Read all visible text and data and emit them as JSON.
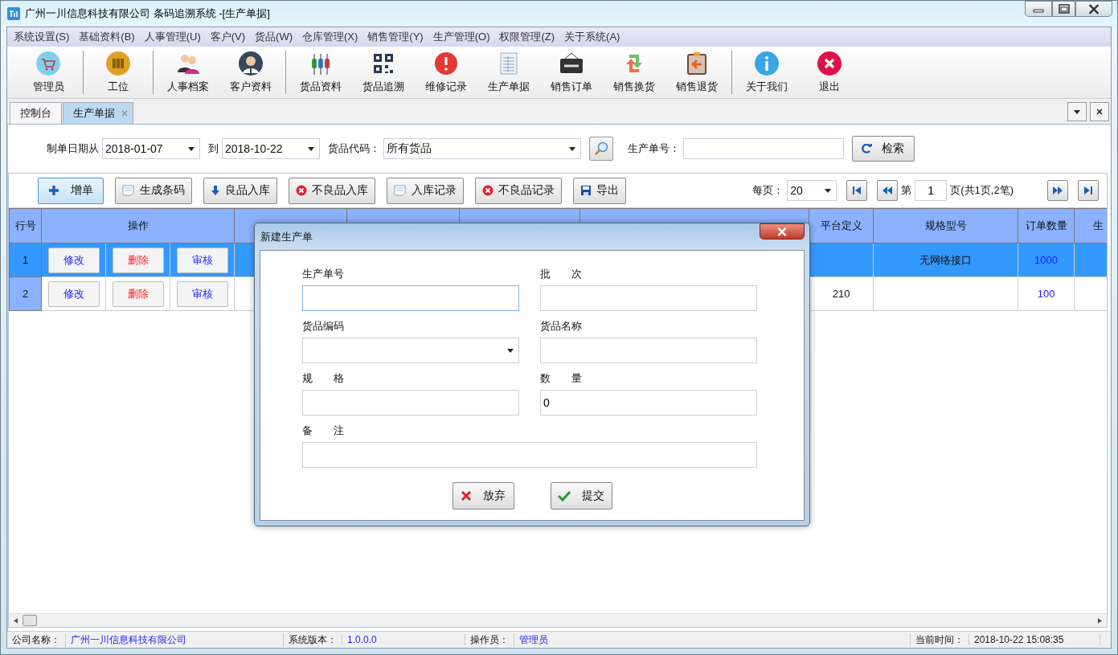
{
  "window": {
    "title": "广州一川信息科技有限公司 条码追溯系统 -[生产单据]"
  },
  "menu": [
    "系统设置(S)",
    "基础资料(B)",
    "人事管理(U)",
    "客户(V)",
    "货品(W)",
    "仓库管理(X)",
    "销售管理(Y)",
    "生产管理(O)",
    "权限管理(Z)",
    "关于系统(A)"
  ],
  "toolbar_groups": [
    [
      {
        "label": "管理员",
        "kind": "cart"
      }
    ],
    [
      {
        "label": "工位",
        "kind": "barcode"
      }
    ],
    [
      {
        "label": "人事档案",
        "kind": "people"
      },
      {
        "label": "客户资料",
        "kind": "person"
      }
    ],
    [
      {
        "label": "货品资料",
        "kind": "plugs"
      },
      {
        "label": "货品追溯",
        "kind": "qr"
      },
      {
        "label": "维修记录",
        "kind": "alert"
      },
      {
        "label": "生产单据",
        "kind": "sheet"
      },
      {
        "label": "销售订单",
        "kind": "sign"
      },
      {
        "label": "销售换货",
        "kind": "swap"
      },
      {
        "label": "销售退货",
        "kind": "clipboard"
      }
    ],
    [
      {
        "label": "关于我们",
        "kind": "info"
      },
      {
        "label": "退出",
        "kind": "exit"
      }
    ]
  ],
  "tabs": [
    {
      "label": "控制台",
      "selected": false,
      "closable": false
    },
    {
      "label": "生产单据",
      "selected": true,
      "closable": true
    }
  ],
  "filter": {
    "date_from_label": "制单日期从",
    "date_from": "2018-01-07",
    "date_to_label": "到",
    "date_to": "2018-10-22",
    "code_label": "货品代码：",
    "code_value": "所有货品",
    "order_label": "生产单号：",
    "search_button": "检索"
  },
  "actions": [
    {
      "label": "增单",
      "kind": "plus",
      "focused": true
    },
    {
      "label": "生成条码",
      "kind": "doc",
      "focused": false
    },
    {
      "label": "良品入库",
      "kind": "down",
      "focused": false
    },
    {
      "label": "不良品入库",
      "kind": "bad",
      "focused": false
    },
    {
      "label": "入库记录",
      "kind": "doc",
      "focused": false
    },
    {
      "label": "不良品记录",
      "kind": "bad",
      "focused": false
    },
    {
      "label": "导出",
      "kind": "save",
      "focused": false
    }
  ],
  "pager": {
    "per_page_label": "每页：",
    "per_page": "20",
    "page_prefix": "第",
    "page": "1",
    "page_suffix": "页(共1页,2笔)"
  },
  "table": {
    "columns": [
      "行号",
      "操作",
      "平台定义",
      "规格型号",
      "订单数量",
      "生"
    ],
    "rows": [
      {
        "line": "1",
        "selected": true,
        "buttons": [
          {
            "label": "修改",
            "kind": "edit"
          },
          {
            "label": "删除",
            "kind": "delete"
          },
          {
            "label": "审核",
            "kind": "audit"
          }
        ],
        "spec": "无网络接口",
        "quantity": "1000"
      },
      {
        "line": "2",
        "selected": false,
        "buttons": [
          {
            "label": "修改",
            "kind": "edit"
          },
          {
            "label": "删除",
            "kind": "delete"
          },
          {
            "label": "审核",
            "kind": "audit"
          }
        ],
        "platform": "210",
        "quantity": "100"
      }
    ]
  },
  "dialog": {
    "title": "新建生产单",
    "fields": [
      {
        "label": "生产单号",
        "kind": "text",
        "focused": true
      },
      {
        "label": "批　　次",
        "kind": "text",
        "focused": false
      },
      {
        "label": "货品编码",
        "kind": "select",
        "focused": false
      },
      {
        "label": "货品名称",
        "kind": "text",
        "focused": false
      },
      {
        "label": "规　　格",
        "kind": "text",
        "focused": false
      },
      {
        "label": "数　　量",
        "kind": "text",
        "value": "0",
        "focused": false
      },
      {
        "label": "备　　注",
        "kind": "wide",
        "focused": false
      }
    ],
    "buttons": [
      {
        "label": "放弃",
        "kind": "cancel"
      },
      {
        "label": "提交",
        "kind": "ok"
      }
    ]
  },
  "status_bar": [
    {
      "label": "公司名称：",
      "value": "广州一川信息科技有限公司"
    },
    {
      "label": "系统版本：",
      "value": "1.0.0.0"
    },
    {
      "label": "操作员：",
      "value": "管理员"
    },
    {
      "label": "当前时间：",
      "value": "2018-10-22 15:08:35"
    }
  ]
}
